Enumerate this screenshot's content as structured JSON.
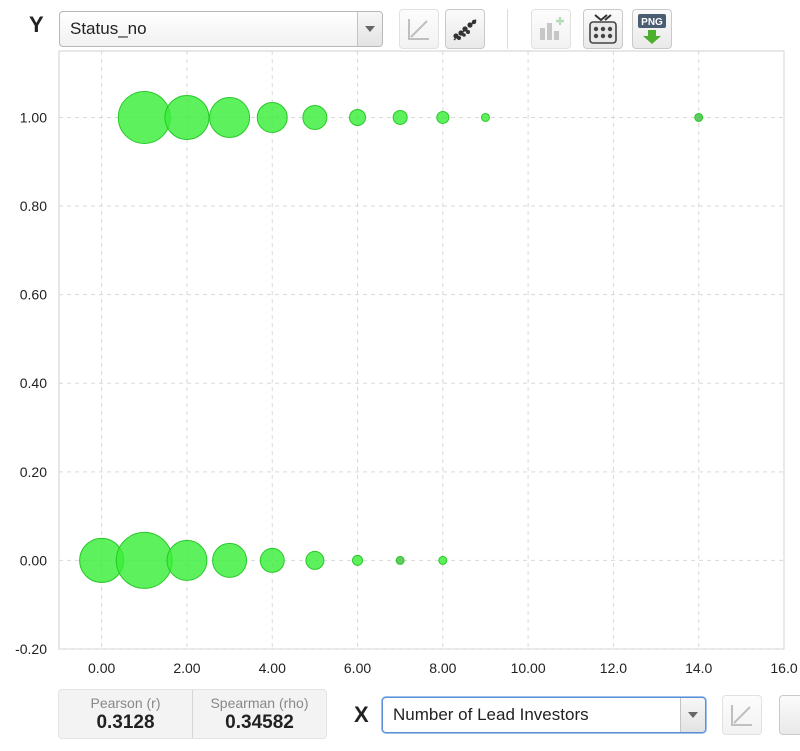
{
  "y_control": {
    "letter": "Y",
    "selected": "Status_no"
  },
  "x_control": {
    "letter": "X",
    "selected": "Number of Lead Investors"
  },
  "toolbar": {
    "buttons": [
      {
        "name": "trendline-button",
        "icon": "line-chart-icon",
        "disabled": true
      },
      {
        "name": "scatter-button",
        "icon": "scatter-icon",
        "disabled": false
      },
      {
        "name": "add-chart-button",
        "icon": "bar-chart-add-icon",
        "disabled": true
      },
      {
        "name": "shuffle-grid-button",
        "icon": "shuffle-grid-icon",
        "disabled": false
      },
      {
        "name": "png-export-button",
        "icon": "png-download-icon",
        "label": "PNG",
        "disabled": false
      }
    ]
  },
  "stats": {
    "pearson": {
      "label": "Pearson (r)",
      "value": "0.3128"
    },
    "spearman": {
      "label": "Spearman (rho)",
      "value": "0.34582"
    }
  },
  "colors": {
    "bubble_fill": "#39ee39",
    "bubble_fill_dark": "#3fbf3f",
    "bubble_stroke": "#29c829",
    "grid": "#d9d9d9"
  },
  "chart_data": {
    "type": "scatter",
    "title": "",
    "xlabel": "Number of Lead Investors",
    "ylabel": "Status_no",
    "xlim": [
      -1,
      16
    ],
    "ylim": [
      -0.2,
      1.15
    ],
    "x_ticks": [
      0,
      2,
      4,
      6,
      8,
      10,
      12,
      14,
      16
    ],
    "x_tick_labels": [
      "0.00",
      "2.00",
      "4.00",
      "6.00",
      "8.00",
      "10.00",
      "12.0",
      "14.0",
      "16.0"
    ],
    "y_ticks": [
      1.0,
      0.8,
      0.6,
      0.4,
      0.2,
      0.0,
      -0.2
    ],
    "y_tick_labels": [
      "1.00",
      "0.80",
      "0.60",
      "0.40",
      "0.20",
      "0.00",
      "-0.20"
    ],
    "grid": true,
    "points": [
      {
        "x": 1,
        "y": 1,
        "size": 26
      },
      {
        "x": 2,
        "y": 1,
        "size": 22
      },
      {
        "x": 3,
        "y": 1,
        "size": 20
      },
      {
        "x": 4,
        "y": 1,
        "size": 15
      },
      {
        "x": 5,
        "y": 1,
        "size": 12
      },
      {
        "x": 6,
        "y": 1,
        "size": 8
      },
      {
        "x": 7,
        "y": 1,
        "size": 7
      },
      {
        "x": 8,
        "y": 1,
        "size": 6
      },
      {
        "x": 9,
        "y": 1,
        "size": 4
      },
      {
        "x": 14,
        "y": 1,
        "size": 4,
        "dark": true
      },
      {
        "x": 0,
        "y": 0,
        "size": 22
      },
      {
        "x": 1,
        "y": 0,
        "size": 28
      },
      {
        "x": 2,
        "y": 0,
        "size": 20
      },
      {
        "x": 3,
        "y": 0,
        "size": 17
      },
      {
        "x": 4,
        "y": 0,
        "size": 12
      },
      {
        "x": 5,
        "y": 0,
        "size": 9
      },
      {
        "x": 6,
        "y": 0,
        "size": 5
      },
      {
        "x": 7,
        "y": 0,
        "size": 4,
        "dark": true
      },
      {
        "x": 8,
        "y": 0,
        "size": 4
      }
    ]
  }
}
